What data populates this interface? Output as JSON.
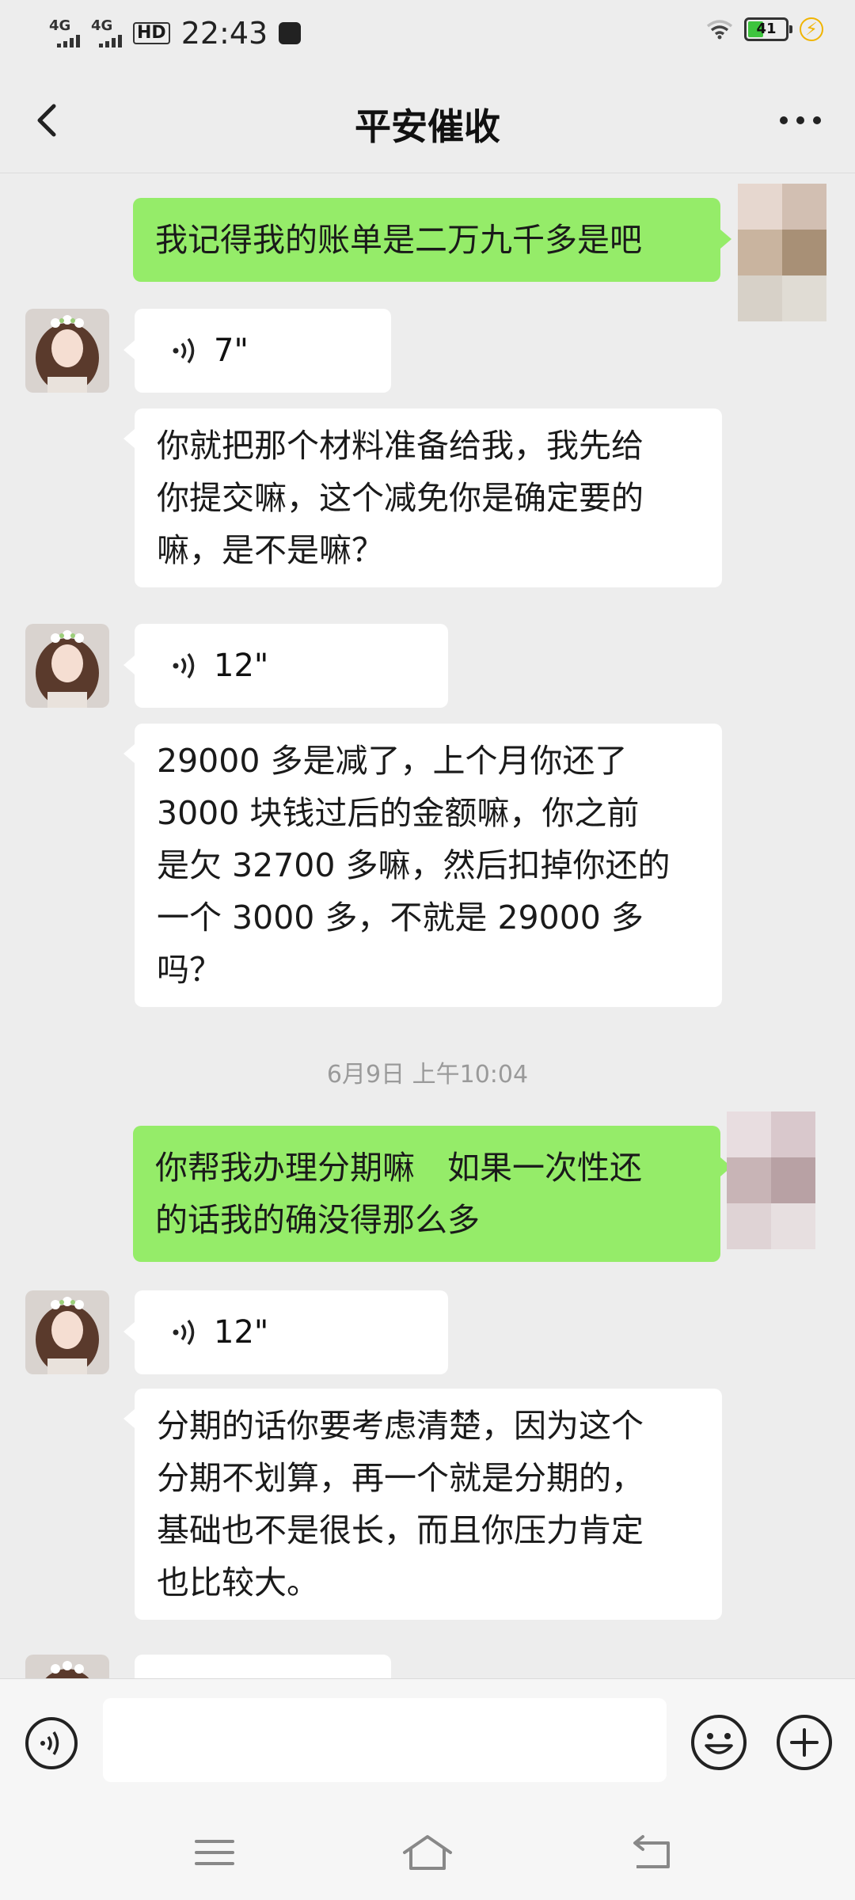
{
  "status_bar": {
    "signal1_label": "4G",
    "signal2_label": "4G",
    "hd_label": "HD",
    "time": "22:43",
    "battery_level": "41",
    "battery_fraction": 0.41
  },
  "header": {
    "title": "平安催收",
    "back_icon": "chevron-left-icon",
    "more_icon": "more-dots-icon"
  },
  "messages": [
    {
      "type": "text",
      "dir": "out",
      "text": "我记得我的账单是二万九千多是吧"
    },
    {
      "type": "voice",
      "dir": "in",
      "duration": "7\""
    },
    {
      "type": "text",
      "dir": "in",
      "lines": [
        "你就把那个材料准备给我，我先给",
        "你提交嘛，这个减免你是确定要的",
        "嘛，是不是嘛？"
      ]
    },
    {
      "type": "voice",
      "dir": "in",
      "duration": "12\""
    },
    {
      "type": "text",
      "dir": "in",
      "lines": [
        "29000 多是减了，上个月你还了",
        "3000 块钱过后的金额嘛，你之前",
        "是欠 32700 多嘛，然后扣掉你还的",
        "一个 3000 多，不就是 29000 多",
        "吗？"
      ]
    },
    {
      "type": "timestamp",
      "text": "6月9日 上午10:04"
    },
    {
      "type": "text",
      "dir": "out",
      "lines": [
        "你帮我办理分期嘛　如果一次性还",
        "的话我的确没得那么多"
      ]
    },
    {
      "type": "voice",
      "dir": "in",
      "duration": "12\""
    },
    {
      "type": "text",
      "dir": "in",
      "lines": [
        "分期的话你要考虑清楚，因为这个",
        "分期不划算，再一个就是分期的，",
        "基础也不是很长，而且你压力肯定",
        "也比较大。"
      ]
    }
  ],
  "input_bar": {
    "voice_icon": "voice-input-icon",
    "emoji_icon": "emoji-icon",
    "plus_icon": "plus-icon",
    "text_value": ""
  },
  "system_nav": [
    "menu-icon",
    "home-icon",
    "back-icon"
  ],
  "colors": {
    "background": "#ededed",
    "outgoing_bubble": "#95ec69",
    "incoming_bubble": "#ffffff",
    "timestamp": "#9a9a9a"
  }
}
